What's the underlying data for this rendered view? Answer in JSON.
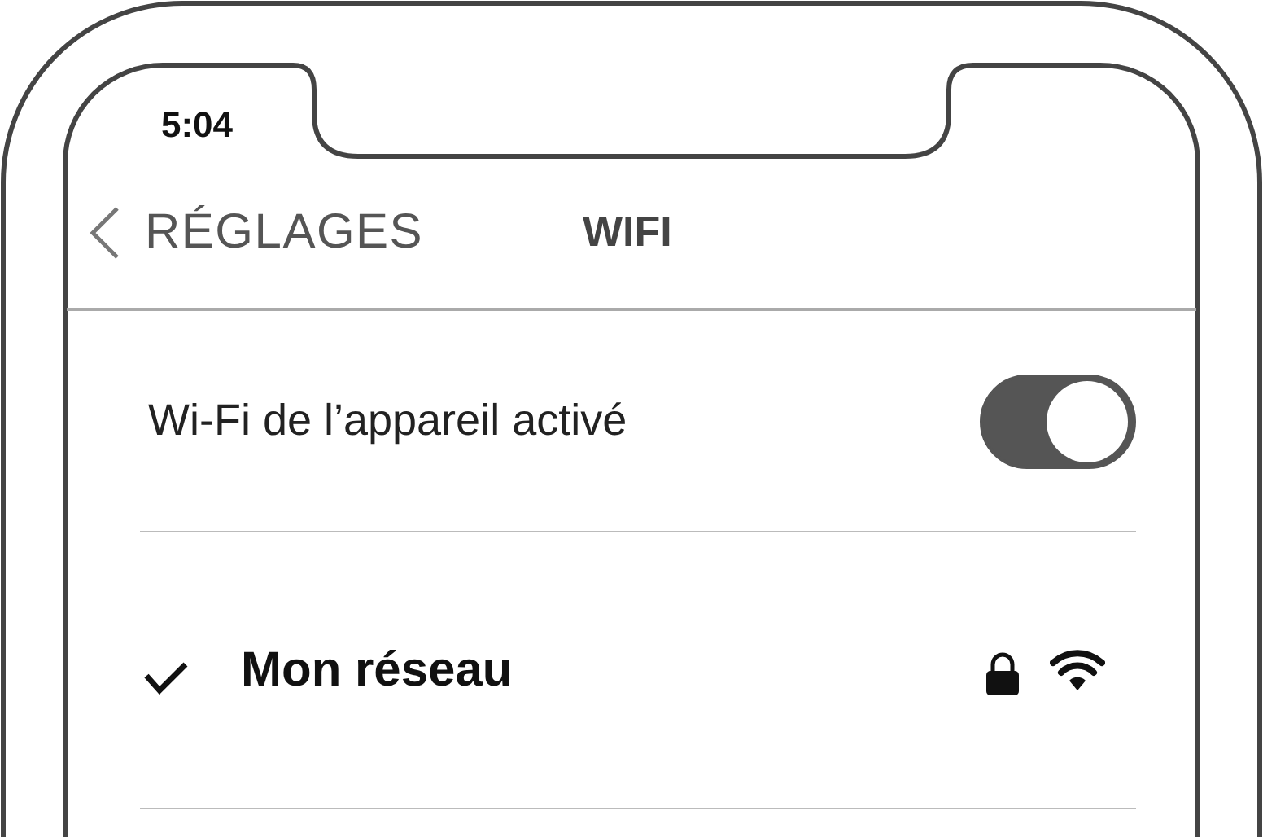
{
  "status_bar": {
    "time": "5:04"
  },
  "nav": {
    "back_label": "RÉGLAGES",
    "title": "WIFI"
  },
  "rows": [
    {
      "kind": "toggle",
      "label": "Wi-Fi de l’appareil activé",
      "on": true
    },
    {
      "kind": "network",
      "name": "Mon réseau",
      "selected": true,
      "locked": true
    }
  ]
}
